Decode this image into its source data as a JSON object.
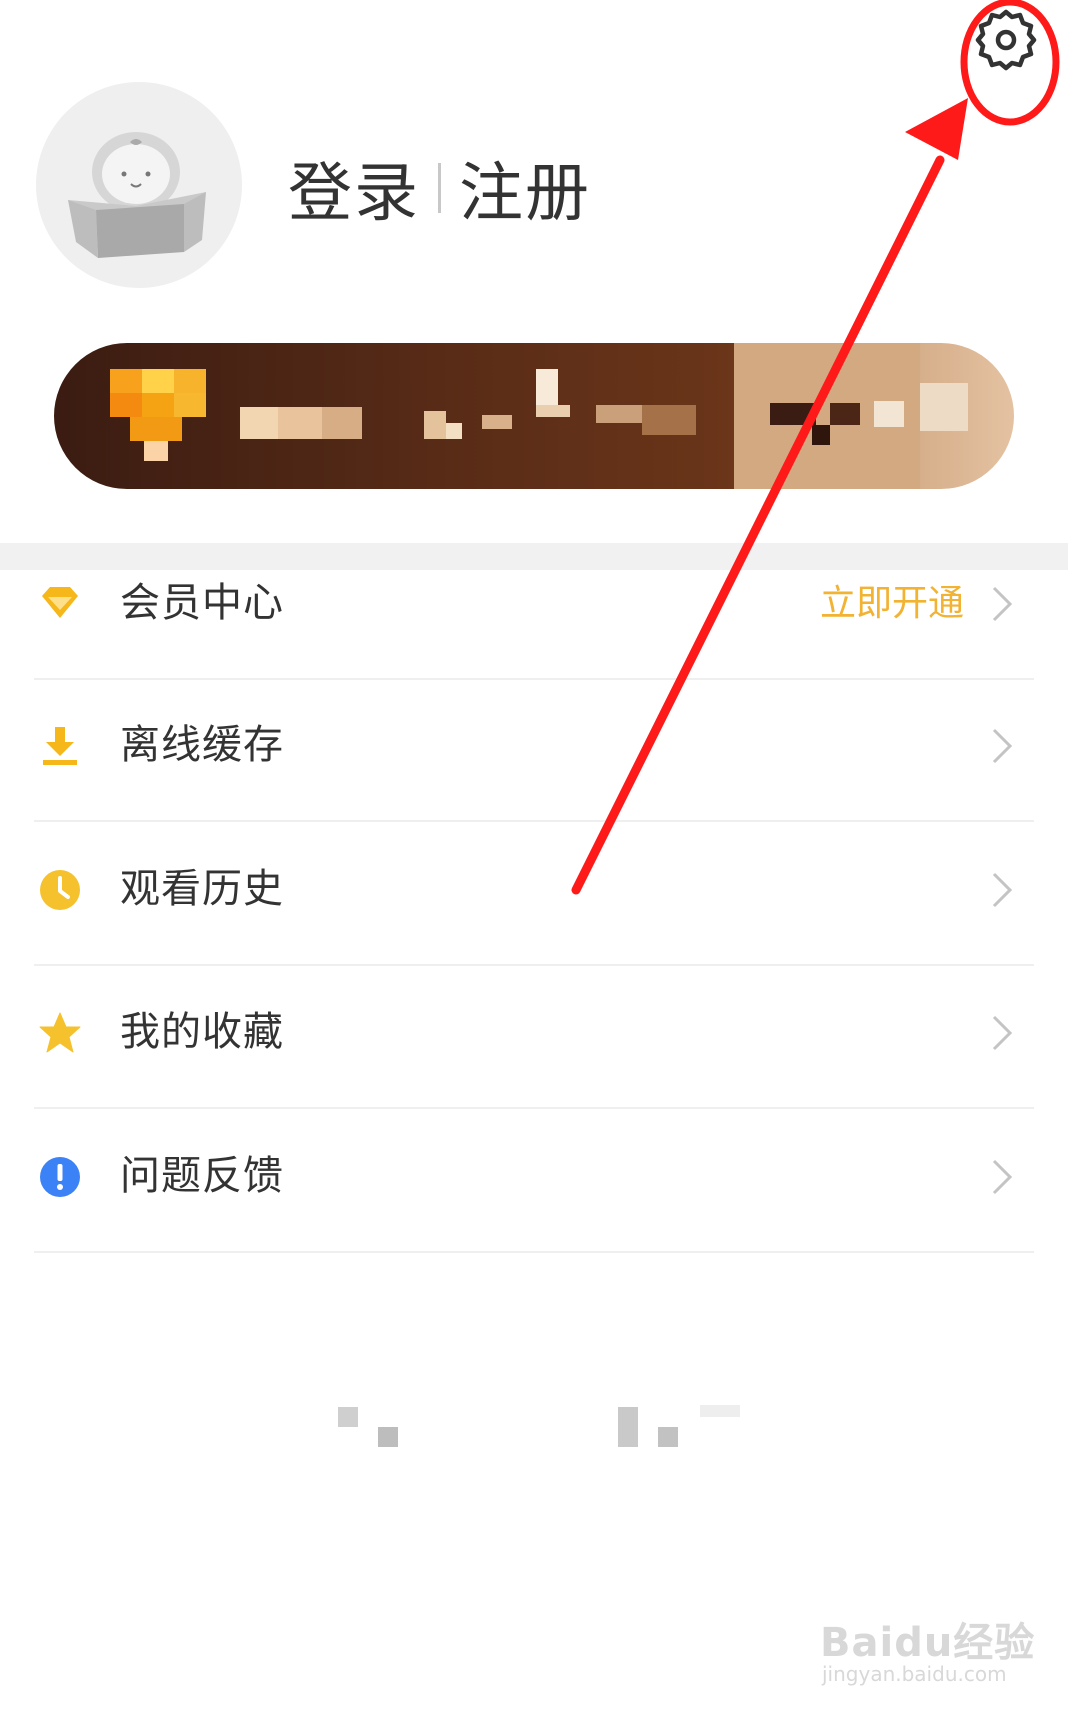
{
  "header": {
    "login_label": "登录",
    "register_label": "注册",
    "settings_icon": "gear-icon",
    "avatar_icon": "astronaut-box-avatar-icon"
  },
  "banner": {
    "crown_icon": "vip-crown-icon"
  },
  "menu": {
    "items": [
      {
        "label": "会员中心",
        "icon": "diamond-icon",
        "action": "立即开通",
        "icon_color": "#f5b71a"
      },
      {
        "label": "离线缓存",
        "icon": "download-icon",
        "icon_color": "#f5b71a"
      },
      {
        "label": "观看历史",
        "icon": "clock-icon",
        "icon_color": "#f5c12c"
      },
      {
        "label": "我的收藏",
        "icon": "star-icon",
        "icon_color": "#f5c12c"
      },
      {
        "label": "问题反馈",
        "icon": "exclamation-icon",
        "icon_color": "#3b82f6"
      }
    ]
  },
  "watermark": {
    "brand": "Baidu经验",
    "url": "jingyan.baidu.com"
  },
  "colors": {
    "accent": "#f2b232",
    "annotation": "#ff1a1a",
    "text": "#333333"
  }
}
